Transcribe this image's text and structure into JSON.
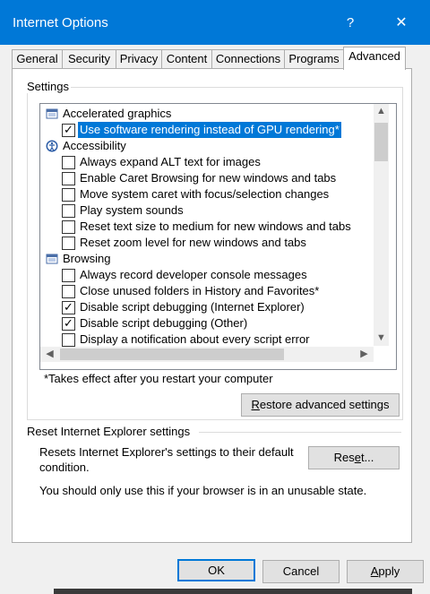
{
  "window": {
    "title": "Internet Options",
    "help_label": "?",
    "close_label": "✕"
  },
  "tabs": [
    {
      "label": "General"
    },
    {
      "label": "Security"
    },
    {
      "label": "Privacy"
    },
    {
      "label": "Content"
    },
    {
      "label": "Connections"
    },
    {
      "label": "Programs"
    },
    {
      "label": "Advanced",
      "active": true
    }
  ],
  "settings": {
    "group_label": "Settings",
    "rows": [
      {
        "type": "group",
        "icon": "folder-icon",
        "label": "Accelerated graphics"
      },
      {
        "type": "checkbox",
        "checked": true,
        "selected": true,
        "label": "Use software rendering instead of GPU rendering*"
      },
      {
        "type": "group",
        "icon": "accessibility-icon",
        "label": "Accessibility"
      },
      {
        "type": "checkbox",
        "checked": false,
        "label": "Always expand ALT text for images"
      },
      {
        "type": "checkbox",
        "checked": false,
        "label": "Enable Caret Browsing for new windows and tabs"
      },
      {
        "type": "checkbox",
        "checked": false,
        "label": "Move system caret with focus/selection changes"
      },
      {
        "type": "checkbox",
        "checked": false,
        "label": "Play system sounds"
      },
      {
        "type": "checkbox",
        "checked": false,
        "label": "Reset text size to medium for new windows and tabs"
      },
      {
        "type": "checkbox",
        "checked": false,
        "label": "Reset zoom level for new windows and tabs"
      },
      {
        "type": "group",
        "icon": "folder-icon",
        "label": "Browsing"
      },
      {
        "type": "checkbox",
        "checked": false,
        "label": "Always record developer console messages"
      },
      {
        "type": "checkbox",
        "checked": false,
        "label": "Close unused folders in History and Favorites*"
      },
      {
        "type": "checkbox",
        "checked": true,
        "label": "Disable script debugging (Internet Explorer)"
      },
      {
        "type": "checkbox",
        "checked": true,
        "label": "Disable script debugging (Other)"
      },
      {
        "type": "checkbox",
        "checked": false,
        "label": "Display a notification about every script error"
      }
    ],
    "restart_note": "*Takes effect after you restart your computer",
    "restore_button": "Restore advanced settings",
    "restore_button_mnemonic": "R",
    "restore_button_rest": "estore advanced settings"
  },
  "reset": {
    "group_label": "Reset Internet Explorer settings",
    "description_line1": "Resets Internet Explorer's settings to their default",
    "description_line2": "condition.",
    "button_pre": "Res",
    "button_mnemonic": "e",
    "button_post": "t...",
    "warning": "You should only use this if your browser is in an unusable state."
  },
  "footer": {
    "ok": "OK",
    "cancel": "Cancel",
    "apply_mnemonic": "A",
    "apply_rest": "pply"
  },
  "colors": {
    "accent": "#0078d7",
    "titlebar": "#0078d7"
  }
}
